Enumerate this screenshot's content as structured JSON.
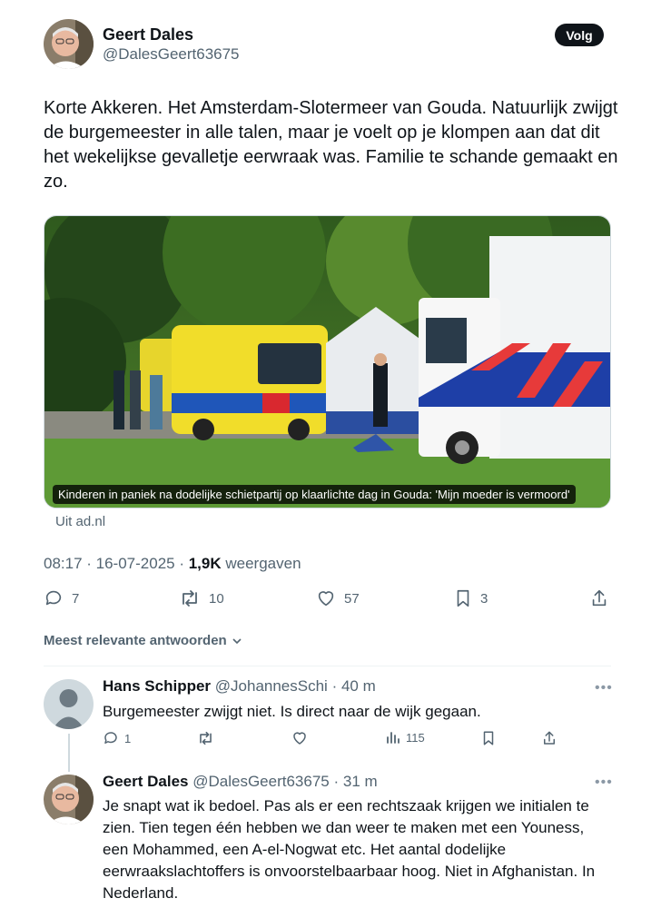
{
  "tweet": {
    "author_name": "Geert Dales",
    "author_handle": "@DalesGeert63675",
    "follow_label": "Volg",
    "text": "Korte Akkeren. Het Amsterdam-Slotermeer van Gouda. Natuurlijk zwijgt de burgemeester in alle talen, maar je voelt op je klompen aan dat dit het wekelijkse gevalletje eerwraak was. Familie te schande gemaakt en zo.",
    "media_caption": "Kinderen in paniek na dodelijke schietpartij op klaarlichte dag in Gouda: 'Mijn moeder is vermoord'",
    "media_source": "Uit ad.nl",
    "time": "08:17 · 16-07-2025 · ",
    "views": "1,9K",
    "views_label": " weergaven",
    "actions": {
      "replies": "7",
      "reposts": "10",
      "likes": "57",
      "bookmarks": "3"
    }
  },
  "sort_label": "Meest relevante antwoorden",
  "replies": [
    {
      "name": "Hans Schipper",
      "handle": "@JohannesSchi",
      "time": "· 40 m",
      "text": "Burgemeester zwijgt niet. Is direct naar de wijk gegaan.",
      "replies": "1",
      "views": "115"
    },
    {
      "name": "Geert Dales",
      "handle": "@DalesGeert63675",
      "time": "· 31 m",
      "text": "Je snapt wat ik bedoel. Pas als er een rechtszaak krijgen we initialen te zien. Tien tegen één hebben we dan weer te maken met een Youness, een Mohammed, een A-el-Nogwat etc. Het aantal dodelijke eerwraakslachtoffers is onvoorstelbaarbaar hoog. Niet in Afghanistan. In Nederland."
    }
  ],
  "icons": {
    "reply": "reply-icon",
    "repost": "repost-icon",
    "like": "heart-icon",
    "bookmark": "bookmark-icon",
    "share": "share-icon",
    "views": "views-icon",
    "more": "more-icon"
  },
  "colors": {
    "text": "#0f1419",
    "secondary": "#536471",
    "follow_bg": "#0f1419"
  }
}
